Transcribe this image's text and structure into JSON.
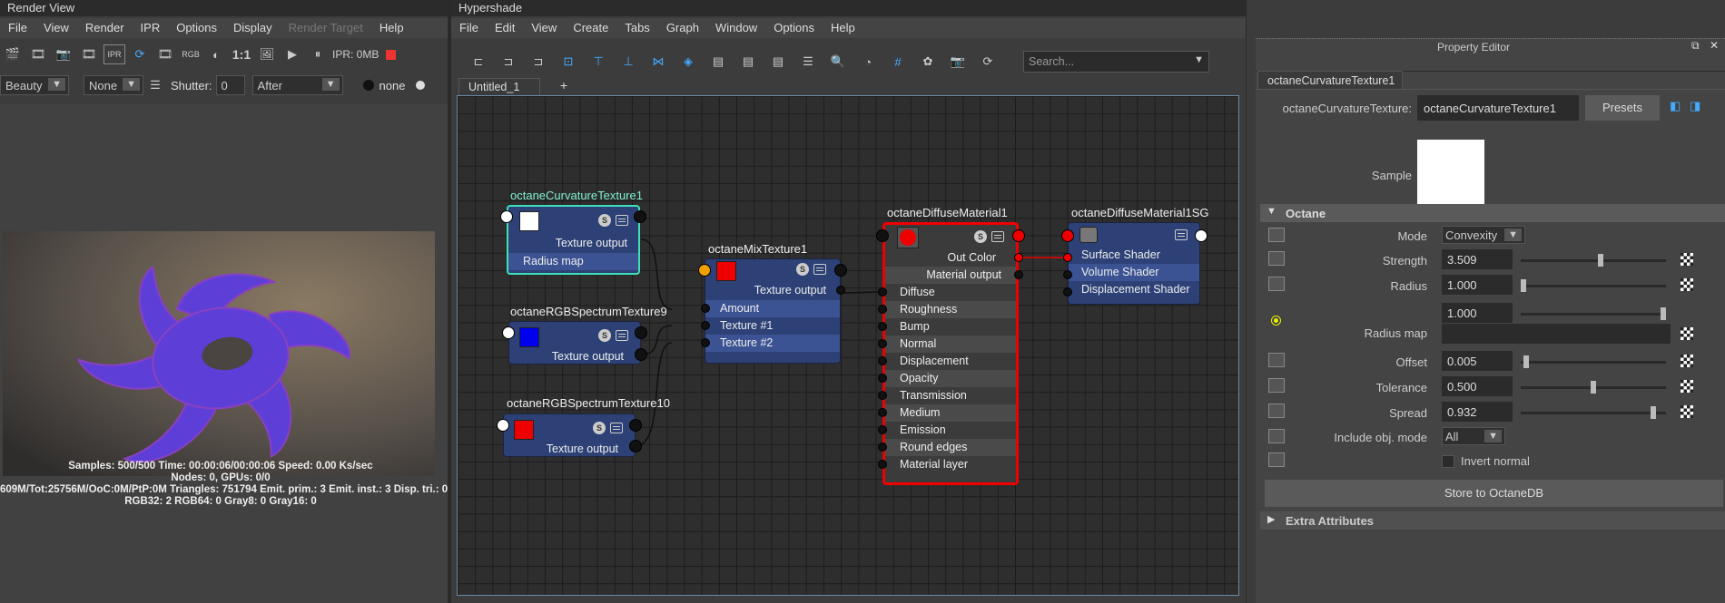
{
  "render_view": {
    "title": "Render View",
    "menu": [
      "File",
      "View",
      "Render",
      "IPR",
      "Options",
      "Display",
      "Render Target",
      "Help"
    ],
    "toolbar_ratio": "1:1",
    "toolbar_ipr_mem": "IPR: 0MB",
    "toolbar_rgb": "RGB",
    "pass_select": "Beauty",
    "none_select": "None",
    "shutter_label": "Shutter:",
    "shutter_value": "0",
    "after_select": "After",
    "none_label": "none",
    "stats": [
      "Samples: 500/500 Time: 00:00:06/00:00:06 Speed: 0.00 Ks/sec",
      "Nodes: 0, GPUs: 0/0",
      "609M/Tot:25756M/OoC:0M/PtP:0M Triangles: 751794 Emit. prim.: 3 Emit. inst.: 3 Disp. tri.: 0",
      "RGB32: 2 RGB64: 0 Gray8: 0 Gray16: 0"
    ]
  },
  "hypershade": {
    "title": "Hypershade",
    "menu": [
      "File",
      "Edit",
      "View",
      "Create",
      "Tabs",
      "Graph",
      "Window",
      "Options",
      "Help"
    ],
    "search_placeholder": "Search...",
    "tabs": [
      "Untitled_1",
      "+"
    ],
    "nodes": {
      "curvature": {
        "title": "octaneCurvatureTexture1",
        "rows": [
          "Texture output",
          "Radius map"
        ]
      },
      "rgb9": {
        "title": "octaneRGBSpectrumTexture9",
        "rows": [
          "Texture output"
        ]
      },
      "rgb10": {
        "title": "octaneRGBSpectrumTexture10",
        "rows": [
          "Texture output"
        ]
      },
      "mix": {
        "title": "octaneMixTexture1",
        "rows": [
          "Texture output",
          "Amount",
          "Texture #1",
          "Texture #2"
        ]
      },
      "diffuse": {
        "title": "octaneDiffuseMaterial1",
        "rows": [
          "Out Color",
          "Material output",
          "Diffuse",
          "Roughness",
          "Bump",
          "Normal",
          "Displacement",
          "Opacity",
          "Transmission",
          "Medium",
          "Emission",
          "Round edges",
          "Material layer"
        ]
      },
      "sg": {
        "title": "octaneDiffuseMaterial1SG",
        "rows": [
          "Surface Shader",
          "Volume Shader",
          "Displacement Shader"
        ]
      }
    },
    "colors": {
      "blue_swatch": "#0000ee",
      "red_swatch": "#ee0000",
      "white_swatch": "#ffffff"
    }
  },
  "property_editor": {
    "title": "Property Editor",
    "tab": "octaneCurvatureTexture1",
    "name_label": "octaneCurvatureTexture:",
    "name_value": "octaneCurvatureTexture1",
    "presets": "Presets",
    "sample_label": "Sample",
    "section_octane": "Octane",
    "mode_label": "Mode",
    "mode_value": "Convexity",
    "strength_label": "Strength",
    "strength_value": "3.509",
    "strength_level": 0.55,
    "radius_label": "Radius",
    "radius_value": "1.000",
    "radius_level": 0.0,
    "radius2_value": "1.000",
    "radius2_level": 1.0,
    "radius_map_label": "Radius map",
    "offset_label": "Offset",
    "offset_value": "0.005",
    "offset_level": 0.02,
    "tolerance_label": "Tolerance",
    "tolerance_value": "0.500",
    "tolerance_level": 0.5,
    "spread_label": "Spread",
    "spread_value": "0.932",
    "spread_level": 0.93,
    "include_label": "Include obj. mode",
    "include_value": "All",
    "invert_label": "Invert normal",
    "store_button": "Store to OctaneDB",
    "extra_section": "Extra Attributes"
  }
}
